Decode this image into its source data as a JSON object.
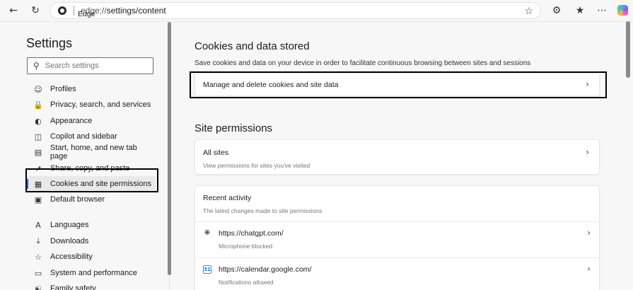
{
  "browser": {
    "site_name": "Edge",
    "url_prefix": "edge://",
    "url_path": "settings/content"
  },
  "sidebar": {
    "title": "Settings",
    "search_placeholder": "Search settings",
    "items": [
      {
        "label": "Profiles",
        "icon": "profile-icon"
      },
      {
        "label": "Privacy, search, and services",
        "icon": "lock-icon"
      },
      {
        "label": "Appearance",
        "icon": "palette-icon"
      },
      {
        "label": "Copilot and sidebar",
        "icon": "sidebar-icon"
      },
      {
        "label": "Start, home, and new tab page",
        "icon": "home-icon"
      },
      {
        "label": "Share, copy, and paste",
        "icon": "share-icon"
      },
      {
        "label": "Cookies and site permissions",
        "icon": "cookie-icon",
        "active": true
      },
      {
        "label": "Default browser",
        "icon": "browser-icon"
      },
      {
        "label": "Languages",
        "icon": "language-icon"
      },
      {
        "label": "Downloads",
        "icon": "download-icon"
      },
      {
        "label": "Accessibility",
        "icon": "accessibility-icon"
      },
      {
        "label": "System and performance",
        "icon": "laptop-icon"
      },
      {
        "label": "Family safety",
        "icon": "family-icon"
      }
    ]
  },
  "main": {
    "cookies_heading": "Cookies and data stored",
    "cookies_desc": "Save cookies and data on your device in order to facilitate continuous browsing between sites and sessions",
    "manage_cookies_label": "Manage and delete cookies and site data",
    "permissions_heading": "Site permissions",
    "all_sites": {
      "title": "All sites",
      "subtitle": "View permissions for sites you've visited"
    },
    "recent": {
      "title": "Recent activity",
      "subtitle": "The latest changes made to site permissions",
      "sites": [
        {
          "name": "https://chatgpt.com/",
          "status": "Microphone blocked",
          "icon": "chatgpt-icon"
        },
        {
          "name": "https://calendar.google.com/",
          "status": "Notifications allowed",
          "icon": "google-calendar-icon"
        }
      ]
    }
  },
  "colors": {
    "accent": "#0f6cbd",
    "highlight_border": "#000000"
  }
}
